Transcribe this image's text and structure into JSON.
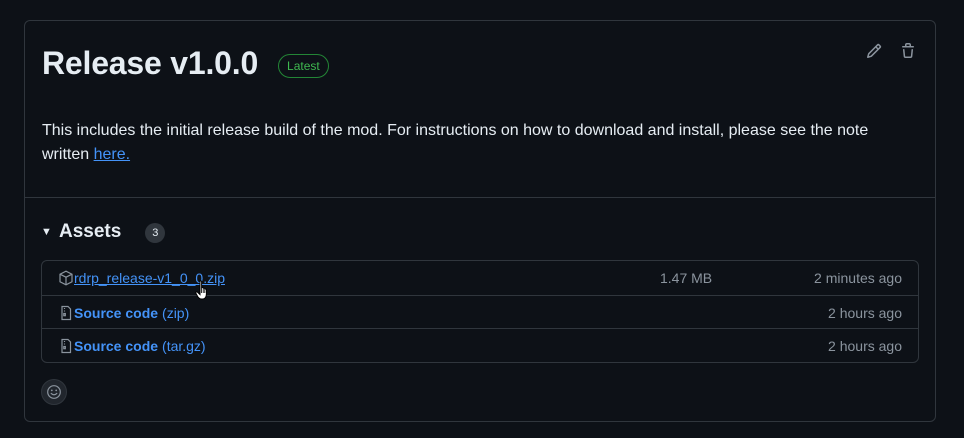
{
  "release": {
    "title": "Release v1.0.0",
    "badge": "Latest",
    "body_prefix": "This includes the initial release build of the mod. For instructions on how to download and install, please see the note written ",
    "body_link": "here."
  },
  "actions": {
    "edit_icon": "pencil-icon",
    "delete_icon": "trash-icon"
  },
  "assets": {
    "title": "Assets",
    "count": "3",
    "items": [
      {
        "name": "rdrp_release-v1_0_0.zip",
        "suffix": "",
        "size": "1.47 MB",
        "time": "2 minutes ago",
        "icon": "package-icon"
      },
      {
        "name": "Source code",
        "suffix": "(zip)",
        "size": "",
        "time": "2 hours ago",
        "icon": "file-zip-icon"
      },
      {
        "name": "Source code",
        "suffix": "(tar.gz)",
        "size": "",
        "time": "2 hours ago",
        "icon": "file-zip-icon"
      }
    ]
  },
  "reactions": {
    "icon": "smiley-icon"
  },
  "colors": {
    "background": "#0d1117",
    "border": "#30363d",
    "link": "#4493f8",
    "latest_green": "#3fb950",
    "muted": "#8b949e"
  }
}
